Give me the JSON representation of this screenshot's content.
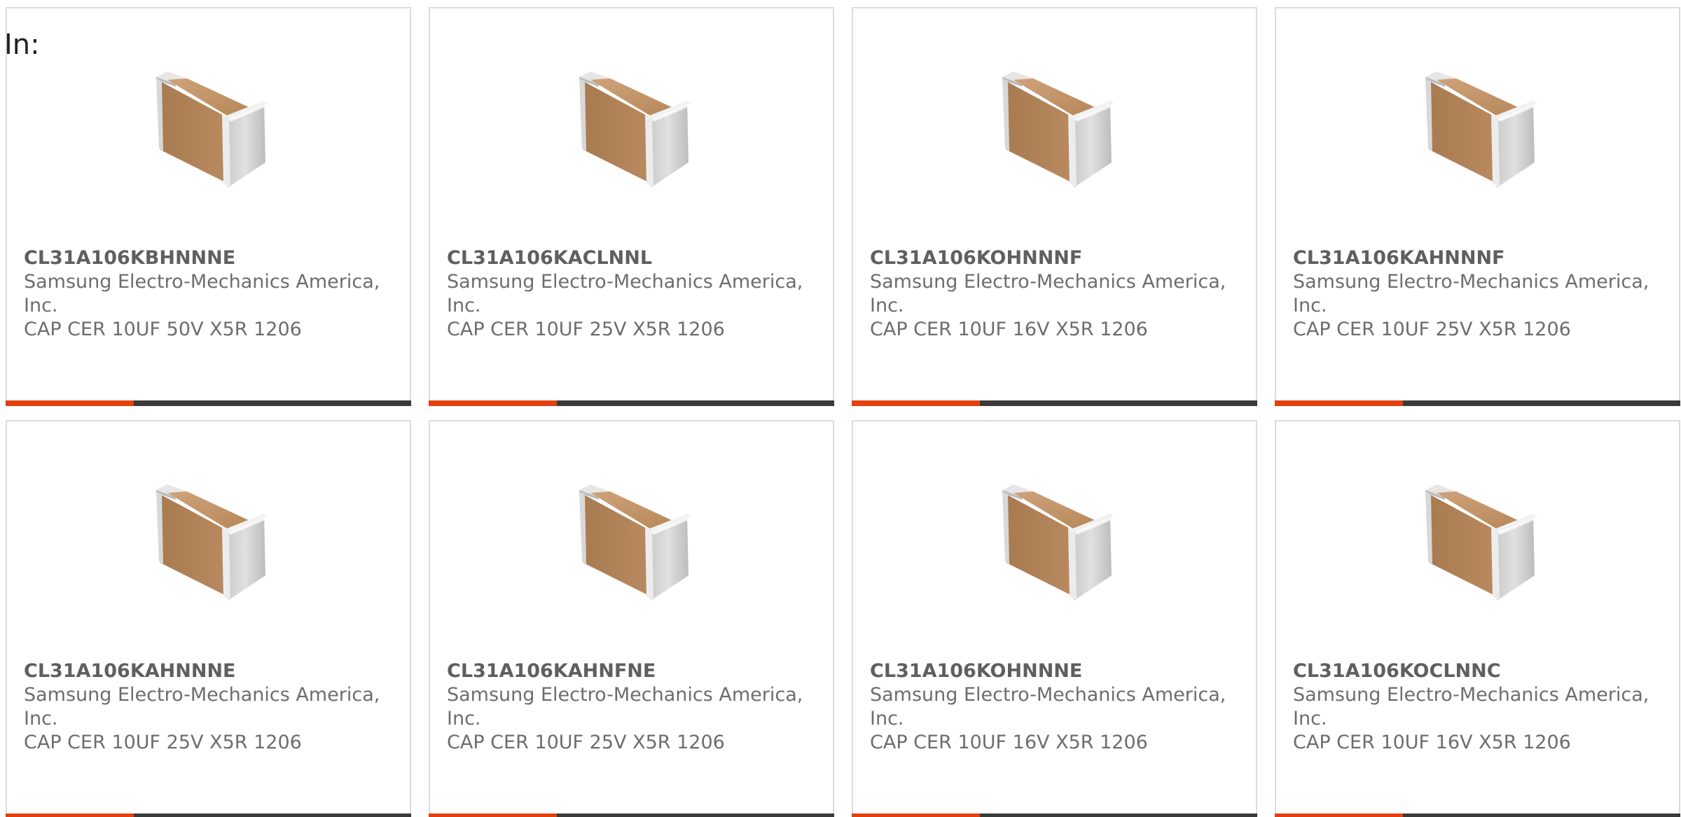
{
  "header": {
    "label": "In:"
  },
  "products": [
    {
      "part_number": "CL31A106KBHNNNE",
      "manufacturer": "Samsung Electro-Mechanics America, Inc.",
      "description": "CAP CER 10UF 50V X5R 1206",
      "image_icon": "capacitor-chip-image"
    },
    {
      "part_number": "CL31A106KACLNNL",
      "manufacturer": "Samsung Electro-Mechanics America, Inc.",
      "description": "CAP CER 10UF 25V X5R 1206",
      "image_icon": "capacitor-chip-image"
    },
    {
      "part_number": "CL31A106KOHNNNF",
      "manufacturer": "Samsung Electro-Mechanics America, Inc.",
      "description": "CAP CER 10UF 16V X5R 1206",
      "image_icon": "capacitor-chip-image"
    },
    {
      "part_number": "CL31A106KAHNNNF",
      "manufacturer": "Samsung Electro-Mechanics America, Inc.",
      "description": "CAP CER 10UF 25V X5R 1206",
      "image_icon": "capacitor-chip-image"
    },
    {
      "part_number": "CL31A106KAHNNNE",
      "manufacturer": "Samsung Electro-Mechanics America, Inc.",
      "description": "CAP CER 10UF 25V X5R 1206",
      "image_icon": "capacitor-chip-image"
    },
    {
      "part_number": "CL31A106KAHNFNE",
      "manufacturer": "Samsung Electro-Mechanics America, Inc.",
      "description": "CAP CER 10UF 25V X5R 1206",
      "image_icon": "capacitor-chip-image"
    },
    {
      "part_number": "CL31A106KOHNNNE",
      "manufacturer": "Samsung Electro-Mechanics America, Inc.",
      "description": "CAP CER 10UF 16V X5R 1206",
      "image_icon": "capacitor-chip-image"
    },
    {
      "part_number": "CL31A106KOCLNNC",
      "manufacturer": "Samsung Electro-Mechanics America, Inc.",
      "description": "CAP CER 10UF 16V X5R 1206",
      "image_icon": "capacitor-chip-image"
    }
  ],
  "colors": {
    "accent": "#e2400f",
    "bar": "#3a3a3a",
    "border": "#dcdcdc",
    "text": "#6d6d6d",
    "chip_body": "#b98a60",
    "chip_terminal": "#d4d4d4"
  }
}
